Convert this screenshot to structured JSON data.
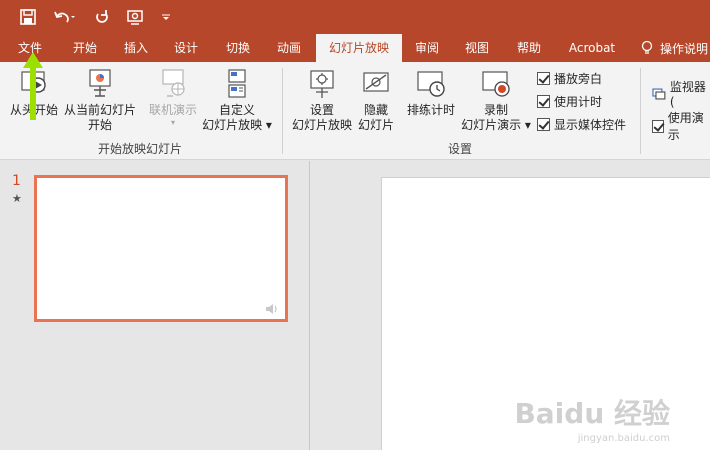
{
  "tabs": [
    {
      "label": "文件"
    },
    {
      "label": "开始"
    },
    {
      "label": "插入"
    },
    {
      "label": "设计"
    },
    {
      "label": "切换"
    },
    {
      "label": "动画"
    },
    {
      "label": "幻灯片放映"
    },
    {
      "label": "审阅"
    },
    {
      "label": "视图"
    },
    {
      "label": "帮助"
    },
    {
      "label": "Acrobat"
    }
  ],
  "tellme": {
    "label": "操作说明"
  },
  "ribbon": {
    "start_group": {
      "from_begin": "从头开始",
      "from_current_1": "从当前幻灯片",
      "from_current_2": "开始",
      "online_present": "联机演示",
      "custom_1": "自定义",
      "custom_2": "幻灯片放映",
      "label": "开始放映幻灯片"
    },
    "setup_group": {
      "setup_1": "设置",
      "setup_2": "幻灯片放映",
      "hide_1": "隐藏",
      "hide_2": "幻灯片",
      "rehearse": "排练计时",
      "record_1": "录制",
      "record_2": "幻灯片演示",
      "play_narrations": "播放旁白",
      "use_timings": "使用计时",
      "show_media_controls": "显示媒体控件",
      "label": "设置"
    },
    "monitors_group": {
      "monitor": "监视器(",
      "use_presenter": "使用演示"
    }
  },
  "thumbnails": [
    {
      "number": "1",
      "star": "★"
    }
  ],
  "watermark": {
    "brand": "Baidu 经验",
    "url": "jingyan.baidu.com"
  },
  "colors": {
    "accent": "#b7472a",
    "selection": "#e97451",
    "arrow": "#9be000"
  }
}
